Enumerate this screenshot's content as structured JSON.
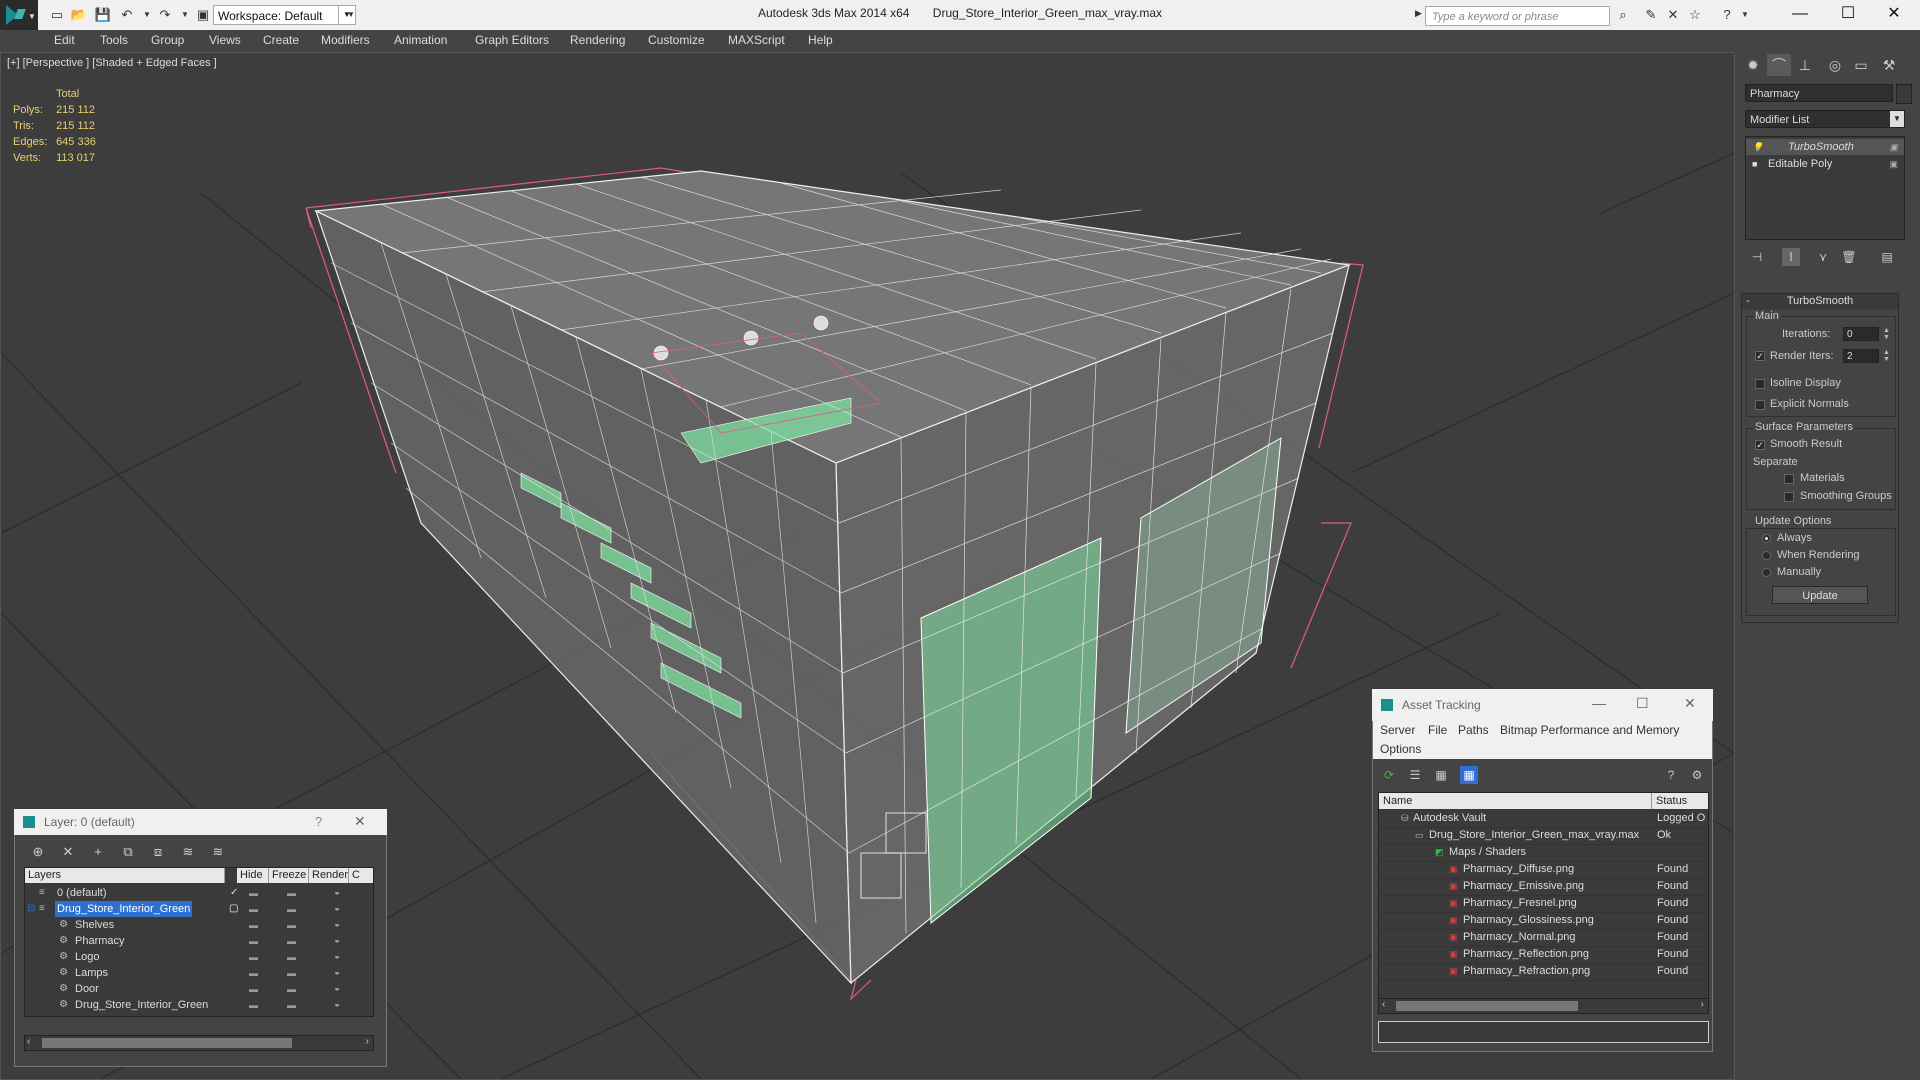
{
  "app": {
    "title_app": "Autodesk 3ds Max  2014 x64",
    "title_file": "Drug_Store_Interior_Green_max_vray.max",
    "workspace": "Workspace: Default",
    "search_placeholder": "Type a keyword or phrase"
  },
  "menu": [
    "Edit",
    "Tools",
    "Group",
    "Views",
    "Create",
    "Modifiers",
    "Animation",
    "Graph Editors",
    "Rendering",
    "Customize",
    "MAXScript",
    "Help"
  ],
  "viewport": {
    "label": "[+] [Perspective ] [Shaded + Edged Faces ]",
    "stats": {
      "header": "Total",
      "rows": [
        {
          "k": "Polys:",
          "v": "215 112"
        },
        {
          "k": "Tris:",
          "v": "215 112"
        },
        {
          "k": "Edges:",
          "v": "645 336"
        },
        {
          "k": "Verts:",
          "v": "113 017"
        }
      ]
    }
  },
  "command_panel": {
    "object_name": "Pharmacy",
    "modifier_list": "Modifier List",
    "stack": [
      "TurboSmooth",
      "Editable Poly"
    ],
    "rollout_title": "TurboSmooth",
    "main_group": "Main",
    "iterations_label": "Iterations:",
    "iterations_value": "0",
    "render_iters_label": "Render Iters:",
    "render_iters_value": "2",
    "isoline": "Isoline Display",
    "explicit_normals": "Explicit Normals",
    "surface_group": "Surface Parameters",
    "smooth_result": "Smooth Result",
    "separate": "Separate",
    "materials": "Materials",
    "smoothing_groups": "Smoothing Groups",
    "update_group": "Update Options",
    "always": "Always",
    "when_rendering": "When Rendering",
    "manually": "Manually",
    "update_button": "Update"
  },
  "layer_dialog": {
    "title": "Layer: 0 (default)",
    "help": "?",
    "close": "✕",
    "columns": [
      "Layers",
      "Hide",
      "Freeze",
      "Render",
      "C"
    ],
    "rows": [
      {
        "name": "0 (default)",
        "level": 0
      },
      {
        "name": "Drug_Store_Interior_Green",
        "level": 0
      },
      {
        "name": "Shelves",
        "level": 1
      },
      {
        "name": "Pharmacy",
        "level": 1
      },
      {
        "name": "Logo",
        "level": 1
      },
      {
        "name": "Lamps",
        "level": 1
      },
      {
        "name": "Door",
        "level": 1
      },
      {
        "name": "Drug_Store_Interior_Green",
        "level": 1
      }
    ]
  },
  "asset_tracking": {
    "title": "Asset Tracking",
    "menu": [
      "Server",
      "File",
      "Paths",
      "Bitmap Performance and Memory",
      "Options"
    ],
    "columns": [
      "Name",
      "Status"
    ],
    "rows": [
      {
        "name": "Autodesk Vault",
        "status": "Logged O",
        "level": 0
      },
      {
        "name": "Drug_Store_Interior_Green_max_vray.max",
        "status": "Ok",
        "level": 1
      },
      {
        "name": "Maps / Shaders",
        "status": "",
        "level": 2
      },
      {
        "name": "Pharmacy_Diffuse.png",
        "status": "Found",
        "level": 3
      },
      {
        "name": "Pharmacy_Emissive.png",
        "status": "Found",
        "level": 3
      },
      {
        "name": "Pharmacy_Fresnel.png",
        "status": "Found",
        "level": 3
      },
      {
        "name": "Pharmacy_Glossiness.png",
        "status": "Found",
        "level": 3
      },
      {
        "name": "Pharmacy_Normal.png",
        "status": "Found",
        "level": 3
      },
      {
        "name": "Pharmacy_Reflection.png",
        "status": "Found",
        "level": 3
      },
      {
        "name": "Pharmacy_Refraction.png",
        "status": "Found",
        "level": 3
      }
    ]
  },
  "colors": {
    "accent": "#1a8f8f",
    "stats_text": "#e8d070",
    "selection": "#2f6fd0",
    "glass_green": "#7fe0a0"
  }
}
